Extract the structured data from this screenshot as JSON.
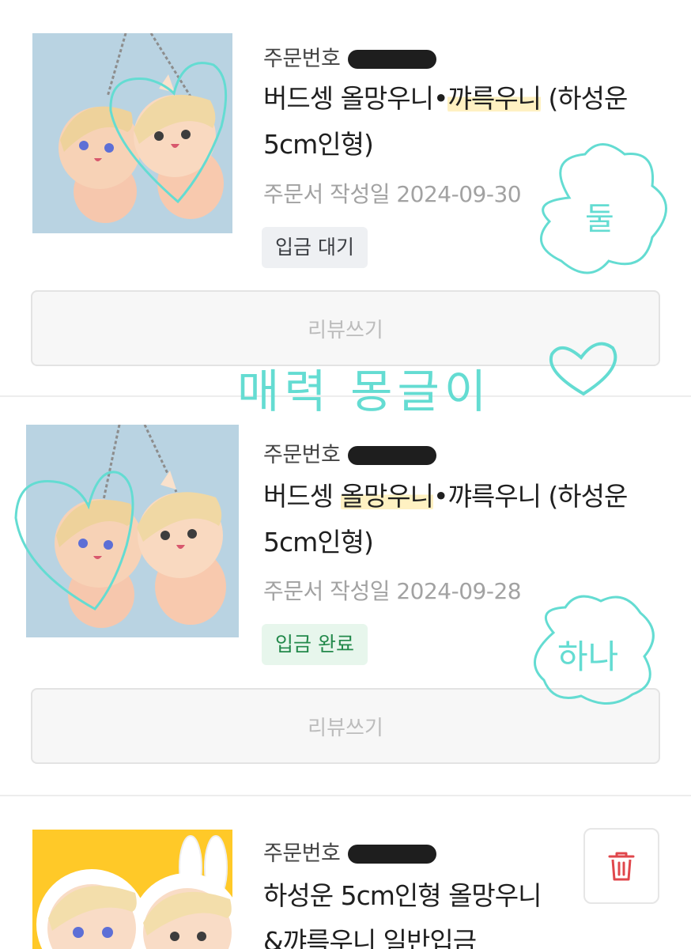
{
  "orders": [
    {
      "order_no_label": "주문번호",
      "title_prefix": "버드셍 올망우니•",
      "title_highlight": "꺄륵우니",
      "title_suffix": " (하성운 5cm인형)",
      "date": "주문서 작성일 2024-09-30",
      "status": "입금 대기",
      "review_label": "리뷰쓰기"
    },
    {
      "order_no_label": "주문번호",
      "title_prefix": "버드셍 ",
      "title_highlight": "올망우니",
      "title_suffix": "•꺄륵우니 (하성운 5cm인형)",
      "date": "주문서 작성일 2024-09-28",
      "status": "입금 완료",
      "review_label": "리뷰쓰기"
    },
    {
      "order_no_label": "주문번호",
      "title": "하성운 5cm인형 올망우니&꺄륵우니 일반입금",
      "delete_icon": "trash-icon"
    }
  ],
  "annotations": {
    "cloud_top": "둘",
    "middle_text": "매력 몽글이",
    "cloud_bottom": "하나"
  },
  "colors": {
    "doodle": "#64dcd2",
    "highlight": "#fff1c2",
    "status_waiting_bg": "#eef0f3",
    "status_done_bg": "#e7f6ec",
    "status_done_text": "#23894b",
    "delete_icon": "#e0474c",
    "thumb_bg_blue": "#b9d3e2",
    "thumb_bg_yellow": "#ffc928"
  }
}
